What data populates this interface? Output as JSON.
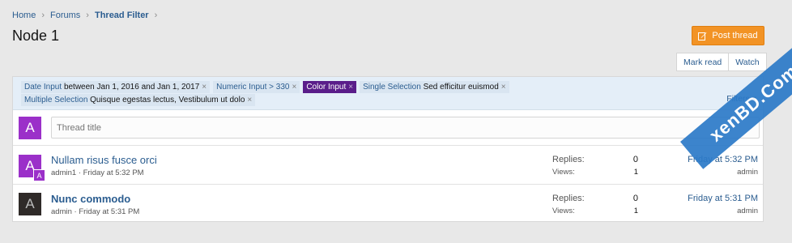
{
  "breadcrumb": {
    "items": [
      "Home",
      "Forums",
      "Thread Filter"
    ],
    "separator": "›"
  },
  "page_title": "Node 1",
  "actions": {
    "post_thread": "Post thread",
    "mark_read": "Mark read",
    "watch": "Watch"
  },
  "filters": {
    "row1": [
      {
        "key": "Date Input",
        "value": "between Jan 1, 2016 and Jan 1, 2017"
      },
      {
        "key": "Numeric Input > 330",
        "value": ""
      },
      {
        "key": "Color Input",
        "value": ""
      },
      {
        "key": "Single Selection",
        "value": "Sed efficitur euismod"
      }
    ],
    "row2": [
      {
        "key": "Multiple Selection",
        "value": "Quisque egestas lectus, Vestibulum ut dolo"
      }
    ],
    "remove_glyph": "×",
    "filters_label": "Filters ▾"
  },
  "quick_thread": {
    "avatar_letter": "A",
    "placeholder": "Thread title"
  },
  "threads": [
    {
      "avatar_letter": "A",
      "mini_avatar_letter": "A",
      "title": "Nullam risus fusce orci",
      "author": "admin1",
      "meta_sep": "·",
      "time": "Friday at 5:32 PM",
      "replies_label": "Replies:",
      "replies": "0",
      "views_label": "Views:",
      "views": "1",
      "last_time": "Friday at 5:32 PM",
      "last_user": "admin"
    },
    {
      "avatar_letter": "A",
      "title": "Nunc commodo",
      "author": "admin",
      "meta_sep": "·",
      "time": "Friday at 5:31 PM",
      "replies_label": "Replies:",
      "replies": "0",
      "views_label": "Views:",
      "views": "1",
      "last_time": "Friday at 5:31 PM",
      "last_user": "admin"
    }
  ],
  "watermark": "xenBD.Com",
  "colors": {
    "link": "#2b5d90",
    "post_button": "#f29325",
    "filter_bar": "#e4eef8",
    "color_tag": "#5a1d8a",
    "avatar_purple": "#9b30c9",
    "avatar_dark": "#2f2a28",
    "watermark": "#2c7ac8"
  }
}
